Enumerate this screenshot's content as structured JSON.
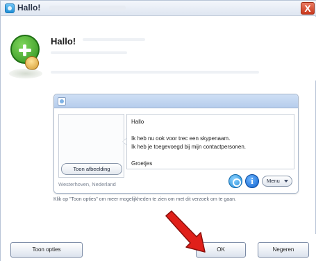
{
  "titlebar": {
    "title": "Hallo!",
    "close_glyph": "X"
  },
  "header": {
    "heading": "Hallo!"
  },
  "card": {
    "show_image_label": "Toon afbeelding",
    "location": "Westerhoven, Nederland",
    "message_lines": [
      "Hallo",
      "",
      "Ik heb nu ook voor trec een skypenaam.",
      "Ik heb je toegevoegd bij mijn contactpersonen.",
      "",
      "Groetjes"
    ],
    "info_glyph": "i",
    "menu_label": "Menu"
  },
  "hint": "Klik op \"Toon opties\" om meer mogelijkheden te zien om met dit verzoek om te gaan.",
  "buttons": {
    "opties": "Toon opties",
    "ok": "OK",
    "negeren": "Negeren"
  },
  "icons": {
    "app": "skype-icon",
    "avatar": "add-contact-icon",
    "card": "contact-card-icon",
    "skype": "skype-icon",
    "info": "info-icon",
    "arrow": "red-arrow-icon"
  },
  "colors": {
    "close": "#c9381d",
    "arrow": "#e0201a",
    "card_header": "#b6cdec"
  }
}
